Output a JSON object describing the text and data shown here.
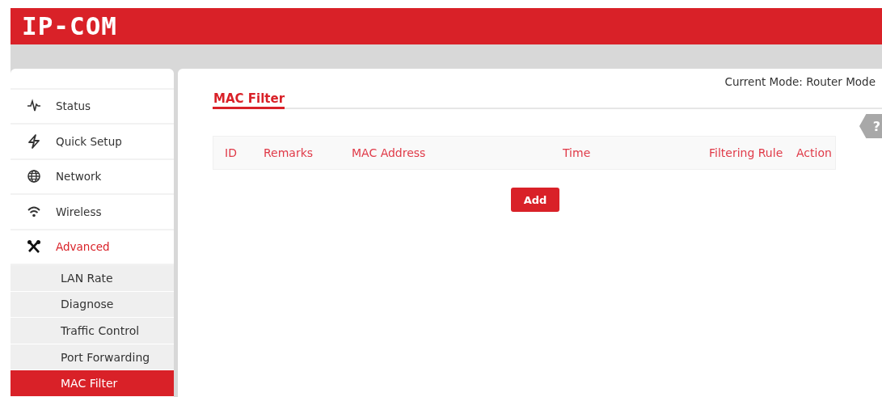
{
  "header": {
    "logo": "IP-COM"
  },
  "sidebar": {
    "items": [
      {
        "label": "Status",
        "kind": "top",
        "expanded": false
      },
      {
        "label": "Quick Setup",
        "kind": "top",
        "expanded": false
      },
      {
        "label": "Network",
        "kind": "top",
        "expanded": false
      },
      {
        "label": "Wireless",
        "kind": "top",
        "expanded": false
      },
      {
        "label": "Advanced",
        "kind": "top",
        "expanded": true,
        "children": [
          {
            "label": "LAN Rate",
            "selected": false
          },
          {
            "label": "Diagnose",
            "selected": false
          },
          {
            "label": "Traffic Control",
            "selected": false
          },
          {
            "label": "Port Forwarding",
            "selected": false
          },
          {
            "label": "MAC Filter",
            "selected": true
          }
        ]
      }
    ]
  },
  "content": {
    "mode": "Current Mode: Router Mode",
    "title": "MAC Filter",
    "help": "?",
    "table": {
      "columns": [
        "ID",
        "Remarks",
        "MAC Address",
        "Time",
        "Filtering Rule",
        "Action"
      ]
    },
    "add_button": "Add"
  }
}
